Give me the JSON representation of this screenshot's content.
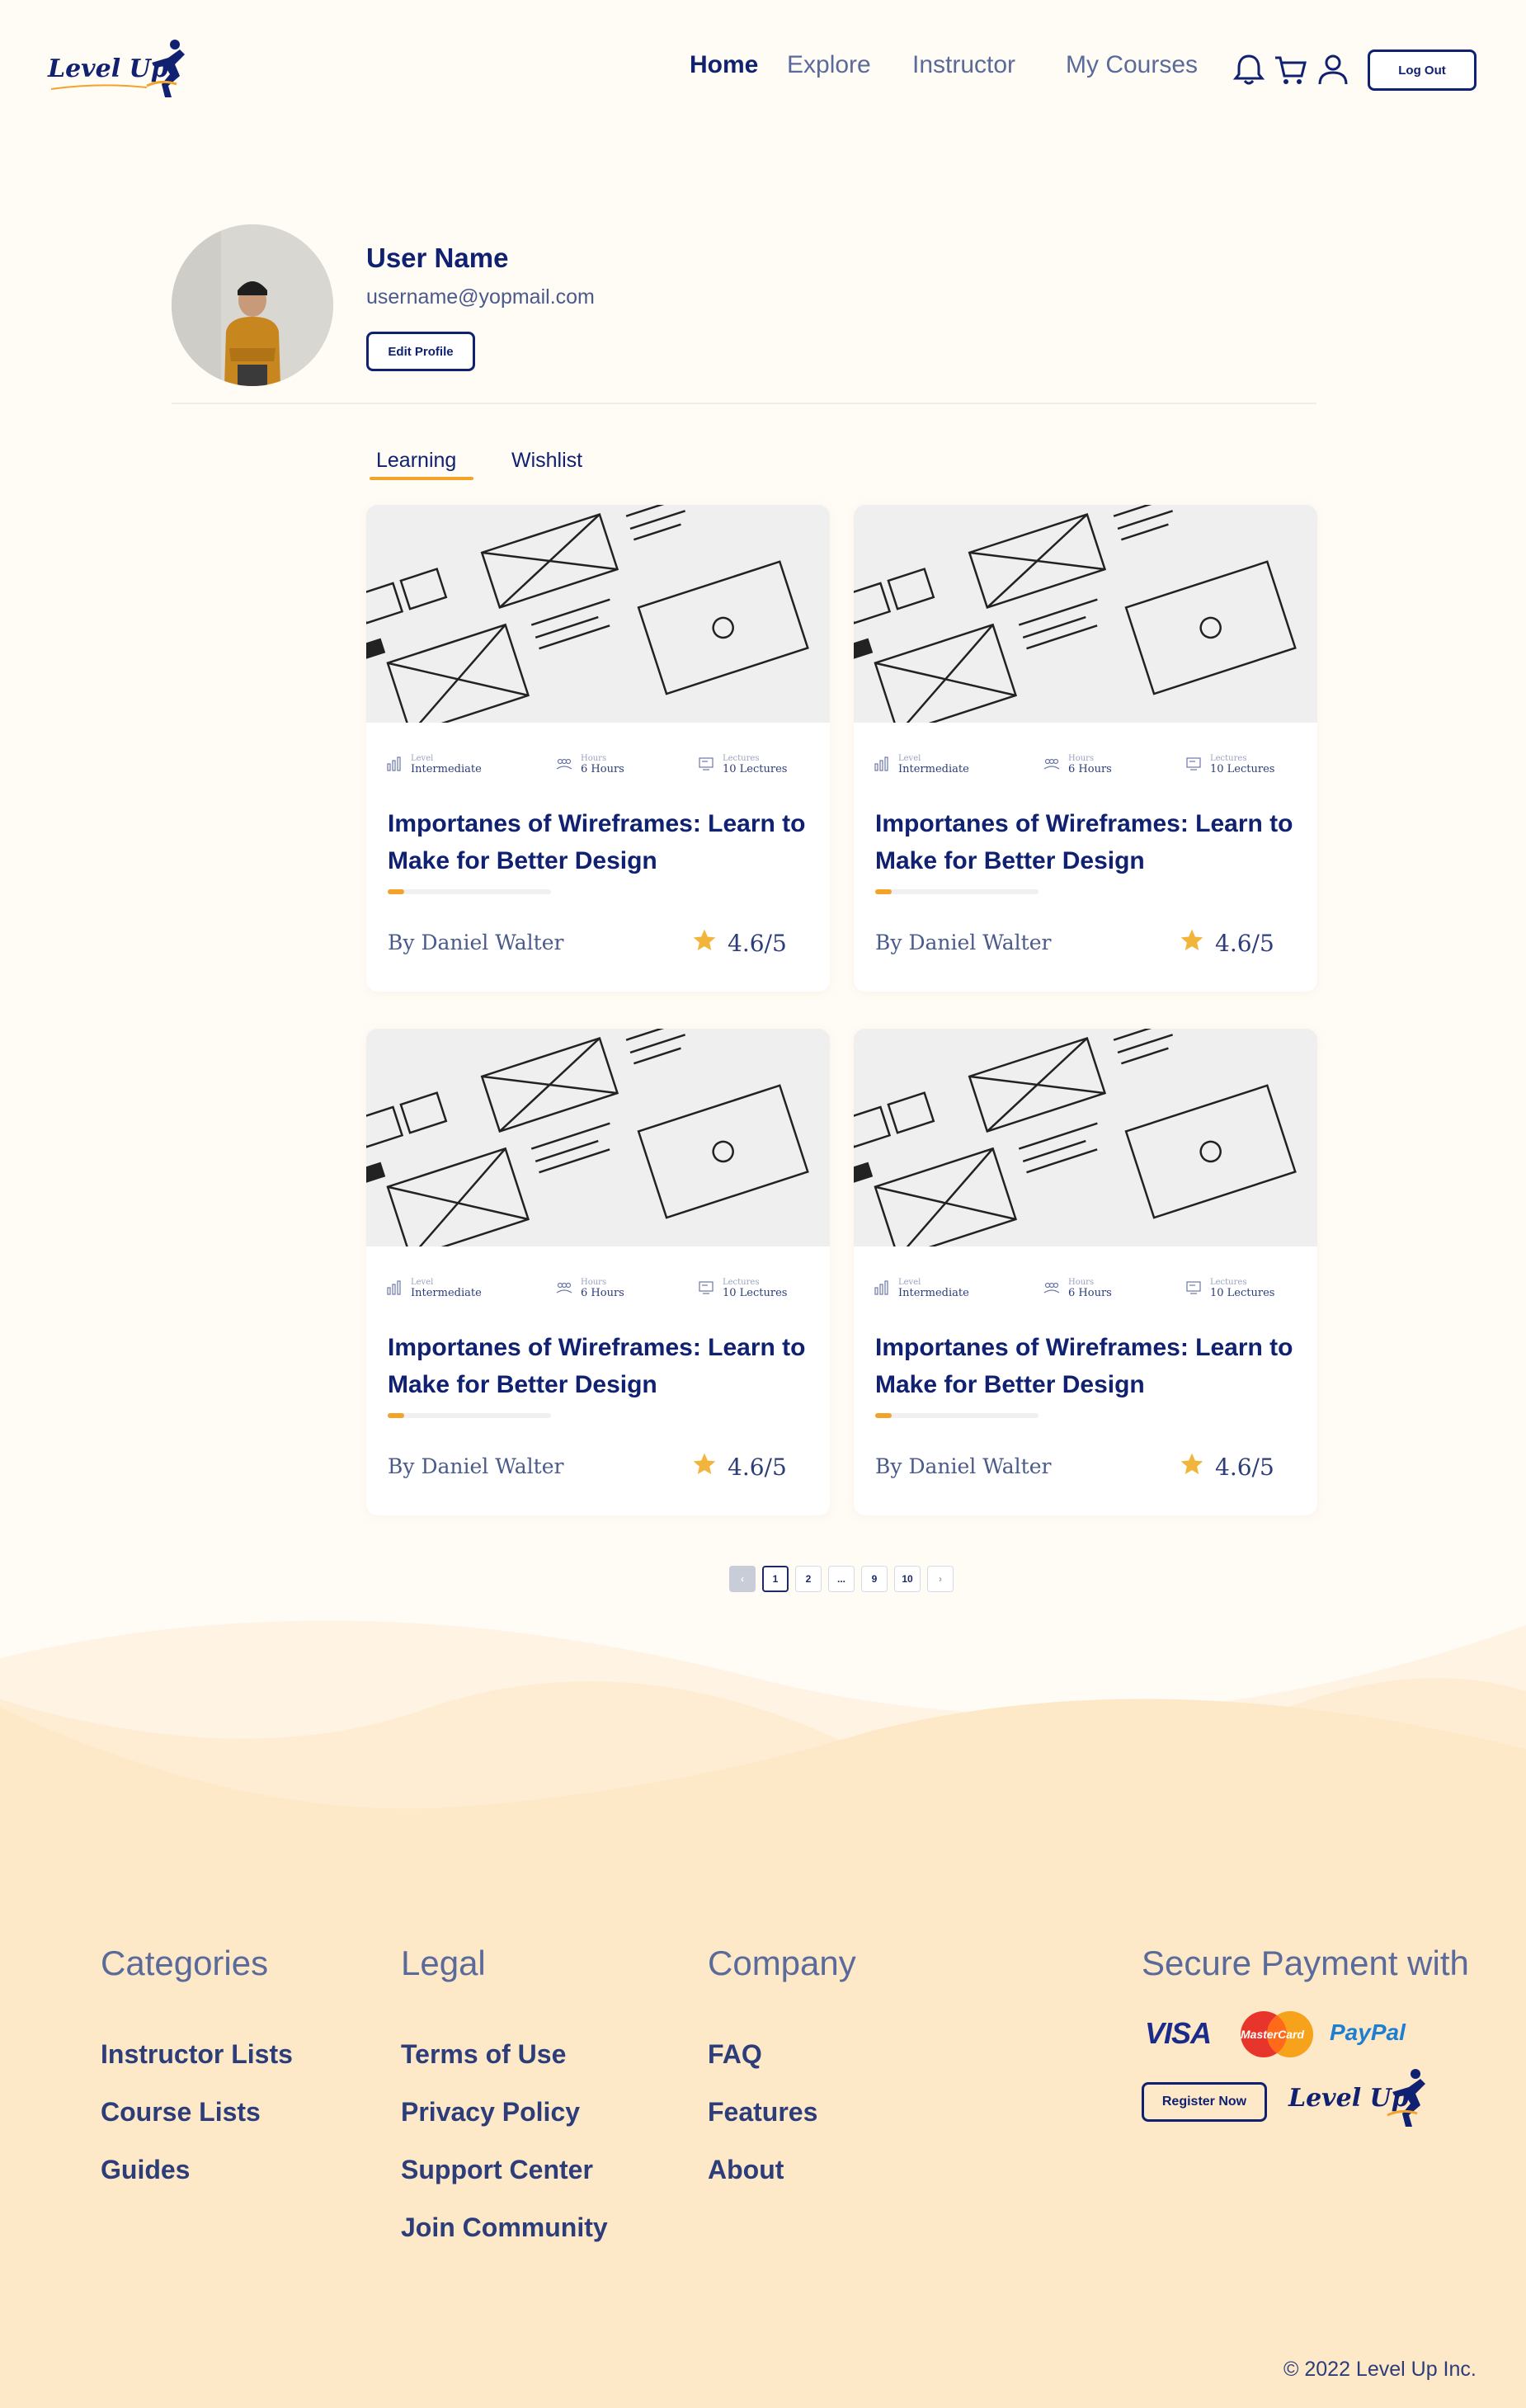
{
  "header": {
    "logo_text": "Level Up",
    "nav": [
      "Home",
      "Explore",
      "Instructor",
      "My Courses"
    ],
    "logout_label": "Log Out"
  },
  "profile": {
    "name": "User Name",
    "email": "username@yopmail.com",
    "edit_label": "Edit Profile"
  },
  "tabs": [
    "Learning",
    "Wishlist"
  ],
  "courses": [
    {
      "level_label": "Level",
      "level": "Intermediate",
      "hours_label": "Hours",
      "hours": "6 Hours",
      "lectures_label": "Lectures",
      "lectures": "10 Lectures",
      "title": "Importanes of Wireframes: Learn to Make for Better Design",
      "author": "By Daniel Walter",
      "rating": "4.6/5",
      "progress": 0.1
    },
    {
      "level_label": "Level",
      "level": "Intermediate",
      "hours_label": "Hours",
      "hours": "6 Hours",
      "lectures_label": "Lectures",
      "lectures": "10 Lectures",
      "title": "Importanes of Wireframes: Learn to Make for Better Design",
      "author": "By Daniel Walter",
      "rating": "4.6/5",
      "progress": 0.1
    },
    {
      "level_label": "Level",
      "level": "Intermediate",
      "hours_label": "Hours",
      "hours": "6 Hours",
      "lectures_label": "Lectures",
      "lectures": "10 Lectures",
      "title": "Importanes of Wireframes: Learn to Make for Better Design",
      "author": "By Daniel Walter",
      "rating": "4.6/5",
      "progress": 0.1
    },
    {
      "level_label": "Level",
      "level": "Intermediate",
      "hours_label": "Hours",
      "hours": "6 Hours",
      "lectures_label": "Lectures",
      "lectures": "10 Lectures",
      "title": "Importanes of Wireframes: Learn to Make for Better Design",
      "author": "By Daniel Walter",
      "rating": "4.6/5",
      "progress": 0.1
    }
  ],
  "pagination": {
    "prev": "‹",
    "pages": [
      "1",
      "2",
      "...",
      "9",
      "10"
    ],
    "next": "›",
    "current": "1"
  },
  "footer": {
    "categories": {
      "title": "Categories",
      "links": [
        "Instructor Lists",
        "Course Lists",
        "Guides"
      ]
    },
    "legal": {
      "title": "Legal",
      "links": [
        "Terms of Use",
        "Privacy Policy",
        "Support Center",
        "Join Community"
      ]
    },
    "company": {
      "title": "Company",
      "links": [
        "FAQ",
        "Features",
        "About"
      ]
    },
    "payment": {
      "title": "Secure Payment with",
      "visa": "VISA",
      "mastercard": "MasterCard",
      "paypal": "PayPal"
    },
    "register_label": "Register Now",
    "logo_text": "Level Up",
    "copyright": "© 2022 Level Up Inc."
  },
  "colors": {
    "brand": "#0f2170",
    "accent": "#f2a42a",
    "background": "#fffbf5",
    "footer": "#fdeacb"
  }
}
